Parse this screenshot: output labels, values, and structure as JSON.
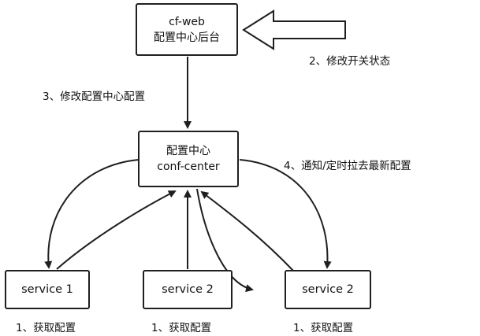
{
  "nodes": {
    "cfweb": {
      "line1": "cf-web",
      "line2": "配置中心后台"
    },
    "center": {
      "line1": "配置中心",
      "line2": "conf-center"
    },
    "service_left": {
      "label": "service 1"
    },
    "service_mid": {
      "label": "service 2"
    },
    "service_right": {
      "label": "service 2"
    }
  },
  "labels": {
    "step2": "2、修改开关状态",
    "step3": "3、修改配置中心配置",
    "step4": "4、通知/定时拉去最新配置",
    "fetch_left": "1、获取配置",
    "fetch_mid": "1、获取配置",
    "fetch_right": "1、获取配置"
  },
  "colors": {
    "line": "#1f1f1f",
    "box_border": "#1f1f1f",
    "text": "#111111"
  }
}
